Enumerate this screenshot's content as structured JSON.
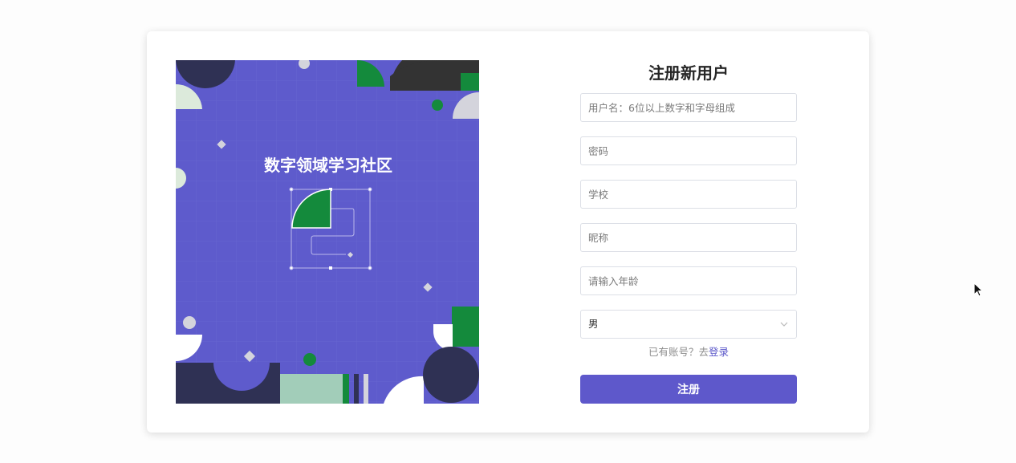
{
  "illustration": {
    "caption": "数字领域学习社区"
  },
  "form": {
    "title": "注册新用户",
    "username_placeholder": "用户名：6位以上数字和字母组成",
    "password_placeholder": "密码",
    "school_placeholder": "学校",
    "nickname_placeholder": "昵称",
    "age_placeholder": "请输入年龄",
    "gender_selected": "男",
    "login_prompt": "已有账号？去",
    "login_link": "登录",
    "submit_label": "注册"
  },
  "colors": {
    "accent": "#5e58cb",
    "illustration_bg": "#5e5bcc",
    "green": "#148a3c",
    "navy": "#2f3154"
  }
}
